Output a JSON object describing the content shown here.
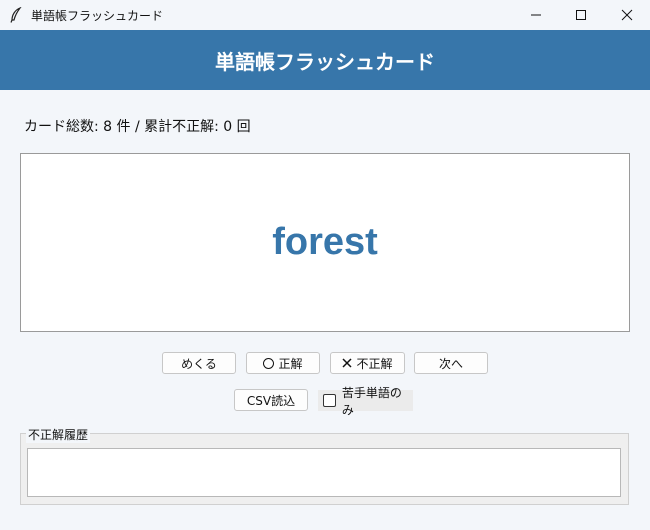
{
  "window": {
    "title": "単語帳フラッシュカード",
    "controls": [
      "minimize-icon",
      "maximize-icon",
      "close-icon"
    ]
  },
  "header": {
    "title": "単語帳フラッシュカード"
  },
  "stats": {
    "text": "カード総数: 8 件 / 累計不正解: 0 回"
  },
  "card": {
    "word": "forest"
  },
  "buttons": {
    "flip": "めくる",
    "correct": "正解",
    "wrong": "不正解",
    "next": "次へ",
    "csv": "CSV読込"
  },
  "filter": {
    "label": "苦手単語のみ",
    "checked": false
  },
  "history": {
    "label": "不正解履歴",
    "entries": []
  },
  "colors": {
    "accent": "#3776aa",
    "background": "#f3f6fa"
  }
}
